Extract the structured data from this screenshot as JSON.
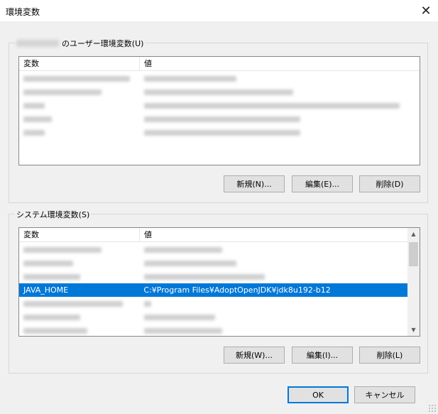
{
  "window": {
    "title": "環境変数",
    "close_icon": "close-icon"
  },
  "user_vars": {
    "group_label": "のユーザー環境変数(U)",
    "columns": [
      "変数",
      "値"
    ],
    "rows": [
      {
        "name": "",
        "value": ""
      },
      {
        "name": "",
        "value": ""
      },
      {
        "name": "",
        "value": ""
      },
      {
        "name": "",
        "value": ""
      },
      {
        "name": "",
        "value": ""
      }
    ],
    "buttons": {
      "new": "新規(N)...",
      "edit": "編集(E)...",
      "delete": "削除(D)"
    }
  },
  "system_vars": {
    "group_label": "システム環境変数(S)",
    "columns": [
      "変数",
      "値"
    ],
    "rows": [
      {
        "name": "",
        "value": "",
        "selected": false
      },
      {
        "name": "",
        "value": "",
        "selected": false
      },
      {
        "name": "",
        "value": "",
        "selected": false
      },
      {
        "name": "JAVA_HOME",
        "value": "C:¥Program Files¥AdoptOpenJDK¥jdk8u192-b12",
        "selected": true
      },
      {
        "name": "",
        "value": "",
        "selected": false
      },
      {
        "name": "",
        "value": "",
        "selected": false
      },
      {
        "name": "",
        "value": "",
        "selected": false
      }
    ],
    "buttons": {
      "new": "新規(W)...",
      "edit": "編集(I)...",
      "delete": "削除(L)"
    }
  },
  "footer": {
    "ok": "OK",
    "cancel": "キャンセル"
  },
  "colors": {
    "selection": "#0078d7",
    "dialog_bg": "#f0f0f0"
  }
}
